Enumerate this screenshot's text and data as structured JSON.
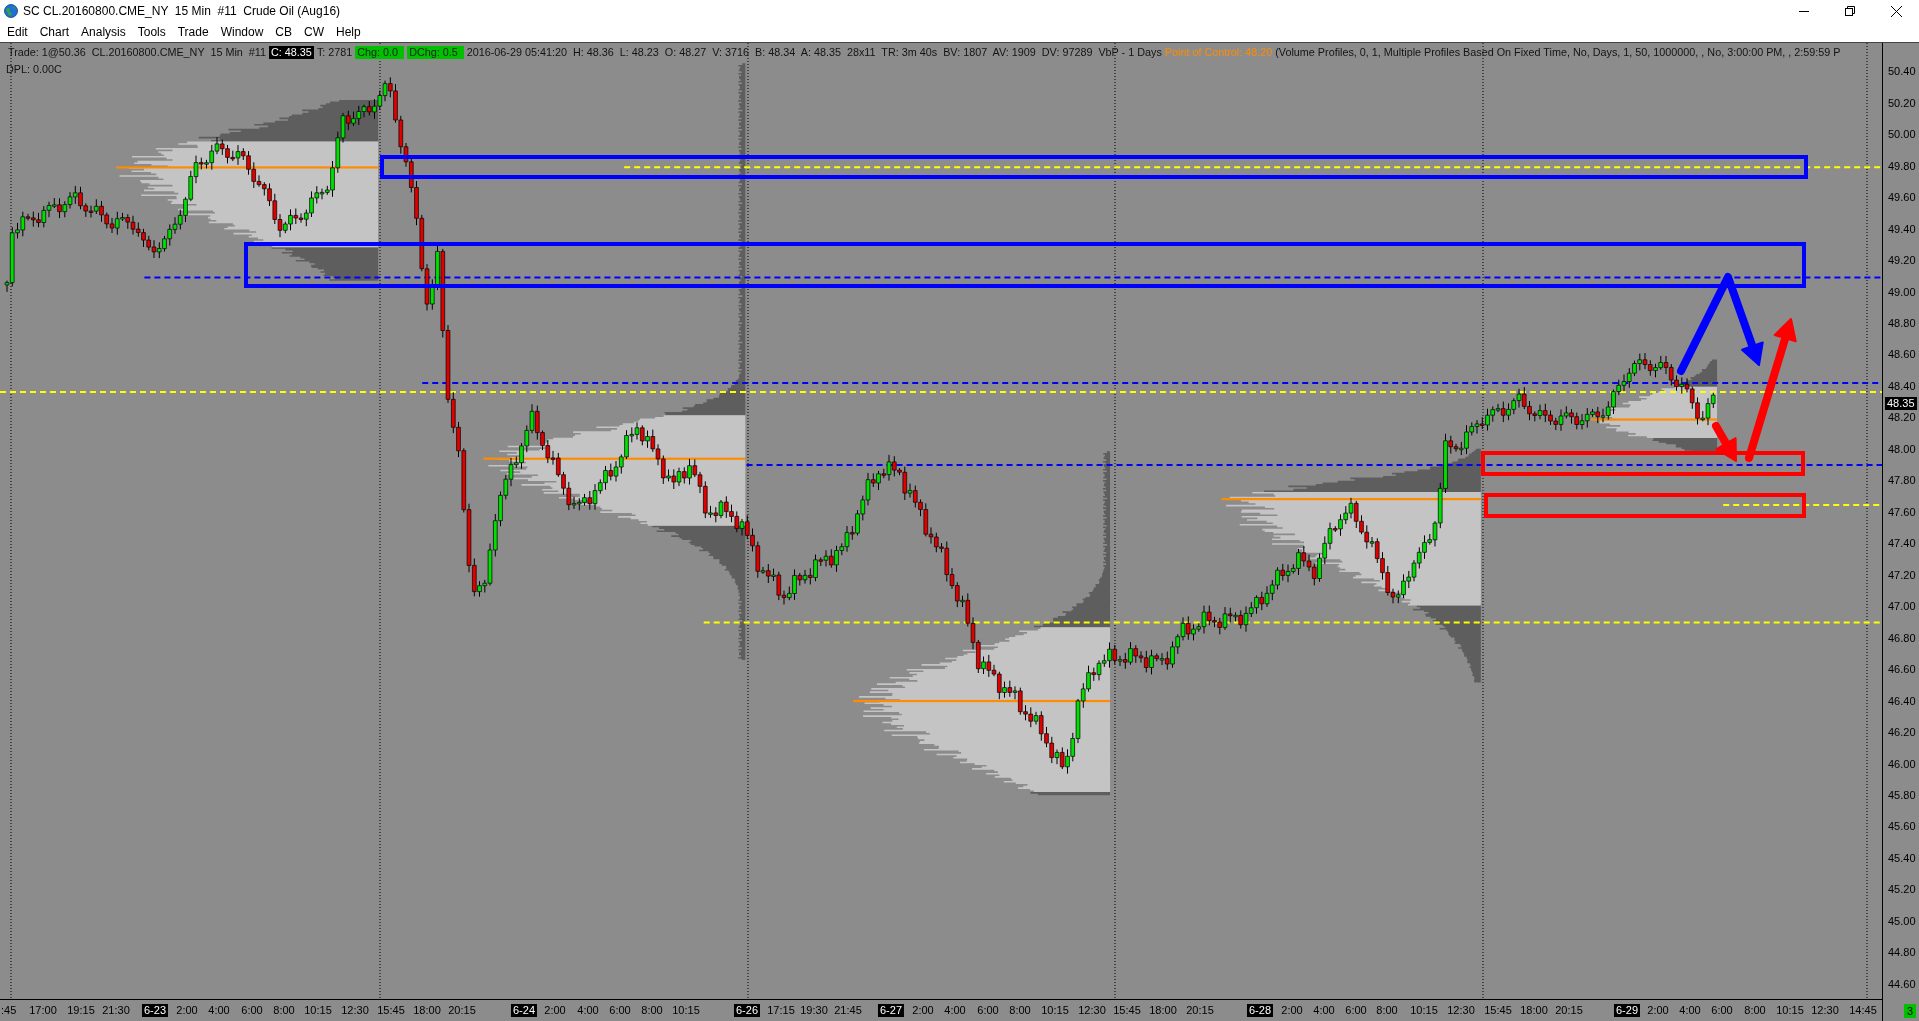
{
  "window": {
    "title": "SC CL.20160800.CME_NY  15 Min  #11  Crude Oil (Aug16)"
  },
  "menu": [
    "Edit",
    "Chart",
    "Analysis",
    "Tools",
    "Trade",
    "Window",
    "CB",
    "CW",
    "Help"
  ],
  "chart": {
    "info_line": [
      {
        "text": "Trade: 1@50.36  CL.20160800.CME_NY  15 Min  #11",
        "kind": "plain"
      },
      {
        "text": "C: 48.35",
        "kind": "inverse"
      },
      {
        "text": "T: 2781",
        "kind": "plain"
      },
      {
        "text": "Chg: 0.0",
        "kind": "green"
      },
      {
        "text": "DChg: 0.5",
        "kind": "green"
      },
      {
        "text": "2016-06-29 05:41:20  H: 48.36  L: 48.23  O: 48.27  V: 3716  B: 48.34  A: 48.35  28x11  TR: 3m 40s  BV: 1807  AV: 1909  DV: 97289  VbP - 1 Days",
        "kind": "plain"
      },
      {
        "text": "Point of Control: 48.20",
        "kind": "orange"
      },
      {
        "text": "(Volume Profiles, 0, 1, Multiple Profiles Based On Fixed Time, No, Days, 1, 50, 1000000, , No, 3:00:00 PM, , 2:59:59 P",
        "kind": "plain"
      }
    ],
    "dpl": "DPL: 0.00C",
    "price_axis": [
      "50.40",
      "50.20",
      "50.00",
      "49.80",
      "49.60",
      "49.40",
      "49.20",
      "49.00",
      "48.80",
      "48.60",
      "48.40",
      "48.20",
      "48.00",
      "47.80",
      "47.60",
      "47.40",
      "47.20",
      "47.00",
      "46.80",
      "46.60",
      "46.40",
      "46.20",
      "46.00",
      "45.80",
      "45.60",
      "45.40",
      "45.20",
      "45.00",
      "44.80",
      "44.60"
    ],
    "current_price": "48.35",
    "time_axis": [
      {
        "label": ":45",
        "kind": "time"
      },
      {
        "label": "17:00",
        "kind": "time"
      },
      {
        "label": "19:15",
        "kind": "time"
      },
      {
        "label": "21:30",
        "kind": "time"
      },
      {
        "label": "6-23",
        "kind": "date"
      },
      {
        "label": "2:00",
        "kind": "time"
      },
      {
        "label": "4:00",
        "kind": "time"
      },
      {
        "label": "6:00",
        "kind": "time"
      },
      {
        "label": "8:00",
        "kind": "time"
      },
      {
        "label": "10:15",
        "kind": "time"
      },
      {
        "label": "12:30",
        "kind": "time"
      },
      {
        "label": "15:45",
        "kind": "time"
      },
      {
        "label": "18:00",
        "kind": "time"
      },
      {
        "label": "20:15",
        "kind": "time"
      },
      {
        "label": "6-24",
        "kind": "date"
      },
      {
        "label": "2:00",
        "kind": "time"
      },
      {
        "label": "4:00",
        "kind": "time"
      },
      {
        "label": "6:00",
        "kind": "time"
      },
      {
        "label": "8:00",
        "kind": "time"
      },
      {
        "label": "10:15",
        "kind": "time"
      },
      {
        "label": "6-26",
        "kind": "date"
      },
      {
        "label": "17:15",
        "kind": "time"
      },
      {
        "label": "19:30",
        "kind": "time"
      },
      {
        "label": "21:45",
        "kind": "time"
      },
      {
        "label": "6-27",
        "kind": "date"
      },
      {
        "label": "2:00",
        "kind": "time"
      },
      {
        "label": "4:00",
        "kind": "time"
      },
      {
        "label": "6:00",
        "kind": "time"
      },
      {
        "label": "8:00",
        "kind": "time"
      },
      {
        "label": "10:15",
        "kind": "time"
      },
      {
        "label": "12:30",
        "kind": "time"
      },
      {
        "label": "15:45",
        "kind": "time"
      },
      {
        "label": "18:00",
        "kind": "time"
      },
      {
        "label": "20:15",
        "kind": "time"
      },
      {
        "label": "6-28",
        "kind": "date"
      },
      {
        "label": "2:00",
        "kind": "time"
      },
      {
        "label": "4:00",
        "kind": "time"
      },
      {
        "label": "6:00",
        "kind": "time"
      },
      {
        "label": "8:00",
        "kind": "time"
      },
      {
        "label": "10:15",
        "kind": "time"
      },
      {
        "label": "12:30",
        "kind": "time"
      },
      {
        "label": "15:45",
        "kind": "time"
      },
      {
        "label": "18:00",
        "kind": "time"
      },
      {
        "label": "20:15",
        "kind": "time"
      },
      {
        "label": "6-29",
        "kind": "date"
      },
      {
        "label": "2:00",
        "kind": "time"
      },
      {
        "label": "4:00",
        "kind": "time"
      },
      {
        "label": "6:00",
        "kind": "time"
      },
      {
        "label": "8:00",
        "kind": "time"
      },
      {
        "label": "10:15",
        "kind": "time"
      },
      {
        "label": "12:30",
        "kind": "time"
      },
      {
        "label": "14:45",
        "kind": "time"
      }
    ],
    "corner_count": "3"
  }
}
